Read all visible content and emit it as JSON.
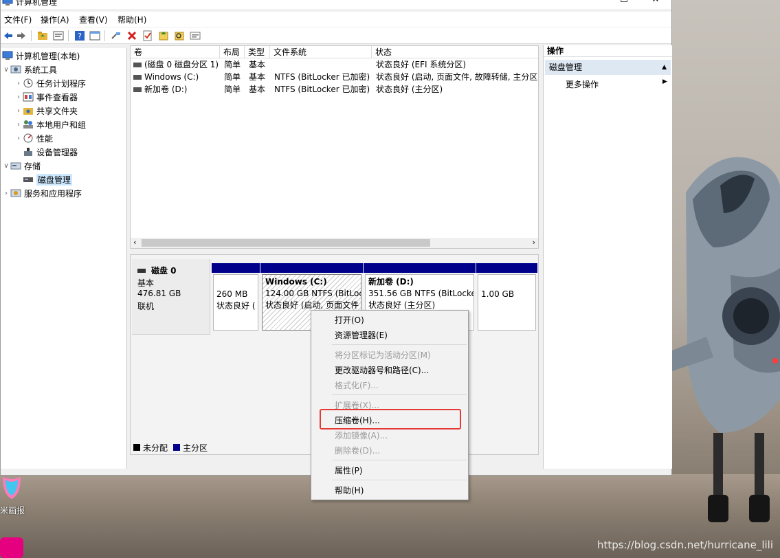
{
  "window": {
    "title": "计算机管理"
  },
  "window_buttons": {
    "minimize": "—",
    "maximize": "☐",
    "close": "✕"
  },
  "menubar": [
    {
      "label": "文件(F)"
    },
    {
      "label": "操作(A)"
    },
    {
      "label": "查看(V)"
    },
    {
      "label": "帮助(H)"
    }
  ],
  "toolbar": [
    "back-icon",
    "forward-icon",
    "up-folder-icon",
    "properties-icon",
    "help-icon",
    "console-icon",
    "connect-icon",
    "delete-icon",
    "check-icon",
    "import-icon",
    "search-icon",
    "export-icon"
  ],
  "tree": {
    "root": "计算机管理(本地)",
    "items": [
      {
        "label": "系统工具",
        "level": 1
      },
      {
        "label": "任务计划程序",
        "level": 2
      },
      {
        "label": "事件查看器",
        "level": 2
      },
      {
        "label": "共享文件夹",
        "level": 2
      },
      {
        "label": "本地用户和组",
        "level": 2
      },
      {
        "label": "性能",
        "level": 2
      },
      {
        "label": "设备管理器",
        "level": 2
      },
      {
        "label": "存储",
        "level": 1
      },
      {
        "label": "磁盘管理",
        "level": 2,
        "selected": true
      },
      {
        "label": "服务和应用程序",
        "level": 1
      }
    ]
  },
  "volumes": {
    "headers": [
      "卷",
      "布局",
      "类型",
      "文件系统",
      "状态"
    ],
    "rows": [
      {
        "name": "(磁盘 0 磁盘分区 1)",
        "layout": "简单",
        "type": "基本",
        "fs": "",
        "status": "状态良好 (EFI 系统分区)"
      },
      {
        "name": "Windows (C:)",
        "layout": "简单",
        "type": "基本",
        "fs": "NTFS (BitLocker 已加密)",
        "status": "状态良好 (启动, 页面文件, 故障转储, 主分区)"
      },
      {
        "name": "新加卷 (D:)",
        "layout": "简单",
        "type": "基本",
        "fs": "NTFS (BitLocker 已加密)",
        "status": "状态良好 (主分区)"
      }
    ]
  },
  "disk": {
    "name": "磁盘 0",
    "type": "基本",
    "size": "476.81 GB",
    "status": "联机",
    "partitions": [
      {
        "title": "",
        "line1": "260 MB",
        "line2": "状态良好 ("
      },
      {
        "title": "Windows  (C:)",
        "line1": "124.00 GB NTFS (BitLoc",
        "line2": "状态良好 (启动, 页面文件"
      },
      {
        "title": "新加卷  (D:)",
        "line1": "351.56 GB NTFS (BitLocke",
        "line2": "状态良好 (主分区)"
      },
      {
        "title": "",
        "line1": "1.00 GB",
        "line2": ""
      }
    ]
  },
  "legend": [
    {
      "label": "未分配",
      "color": "#000000"
    },
    {
      "label": "主分区",
      "color": "#00008b"
    }
  ],
  "actions": {
    "title": "操作",
    "section": "磁盘管理",
    "more": "更多操作"
  },
  "context_menu": {
    "items": [
      {
        "label": "打开(O)",
        "enabled": true
      },
      {
        "label": "资源管理器(E)",
        "enabled": true
      },
      {
        "label": "将分区标记为活动分区(M)",
        "enabled": false
      },
      {
        "label": "更改驱动器号和路径(C)...",
        "enabled": true
      },
      {
        "label": "格式化(F)...",
        "enabled": false
      },
      {
        "label": "扩展卷(X)...",
        "enabled": false
      },
      {
        "label": "压缩卷(H)...",
        "enabled": true,
        "highlighted": true
      },
      {
        "label": "添加镜像(A)...",
        "enabled": false
      },
      {
        "label": "删除卷(D)...",
        "enabled": false
      },
      {
        "label": "属性(P)",
        "enabled": true
      },
      {
        "label": "帮助(H)",
        "enabled": true
      }
    ],
    "highlight_color": "#e53935"
  },
  "desktop": {
    "icon_label": "米画报",
    "watermark": "https://blog.csdn.net/hurricane_lili"
  }
}
